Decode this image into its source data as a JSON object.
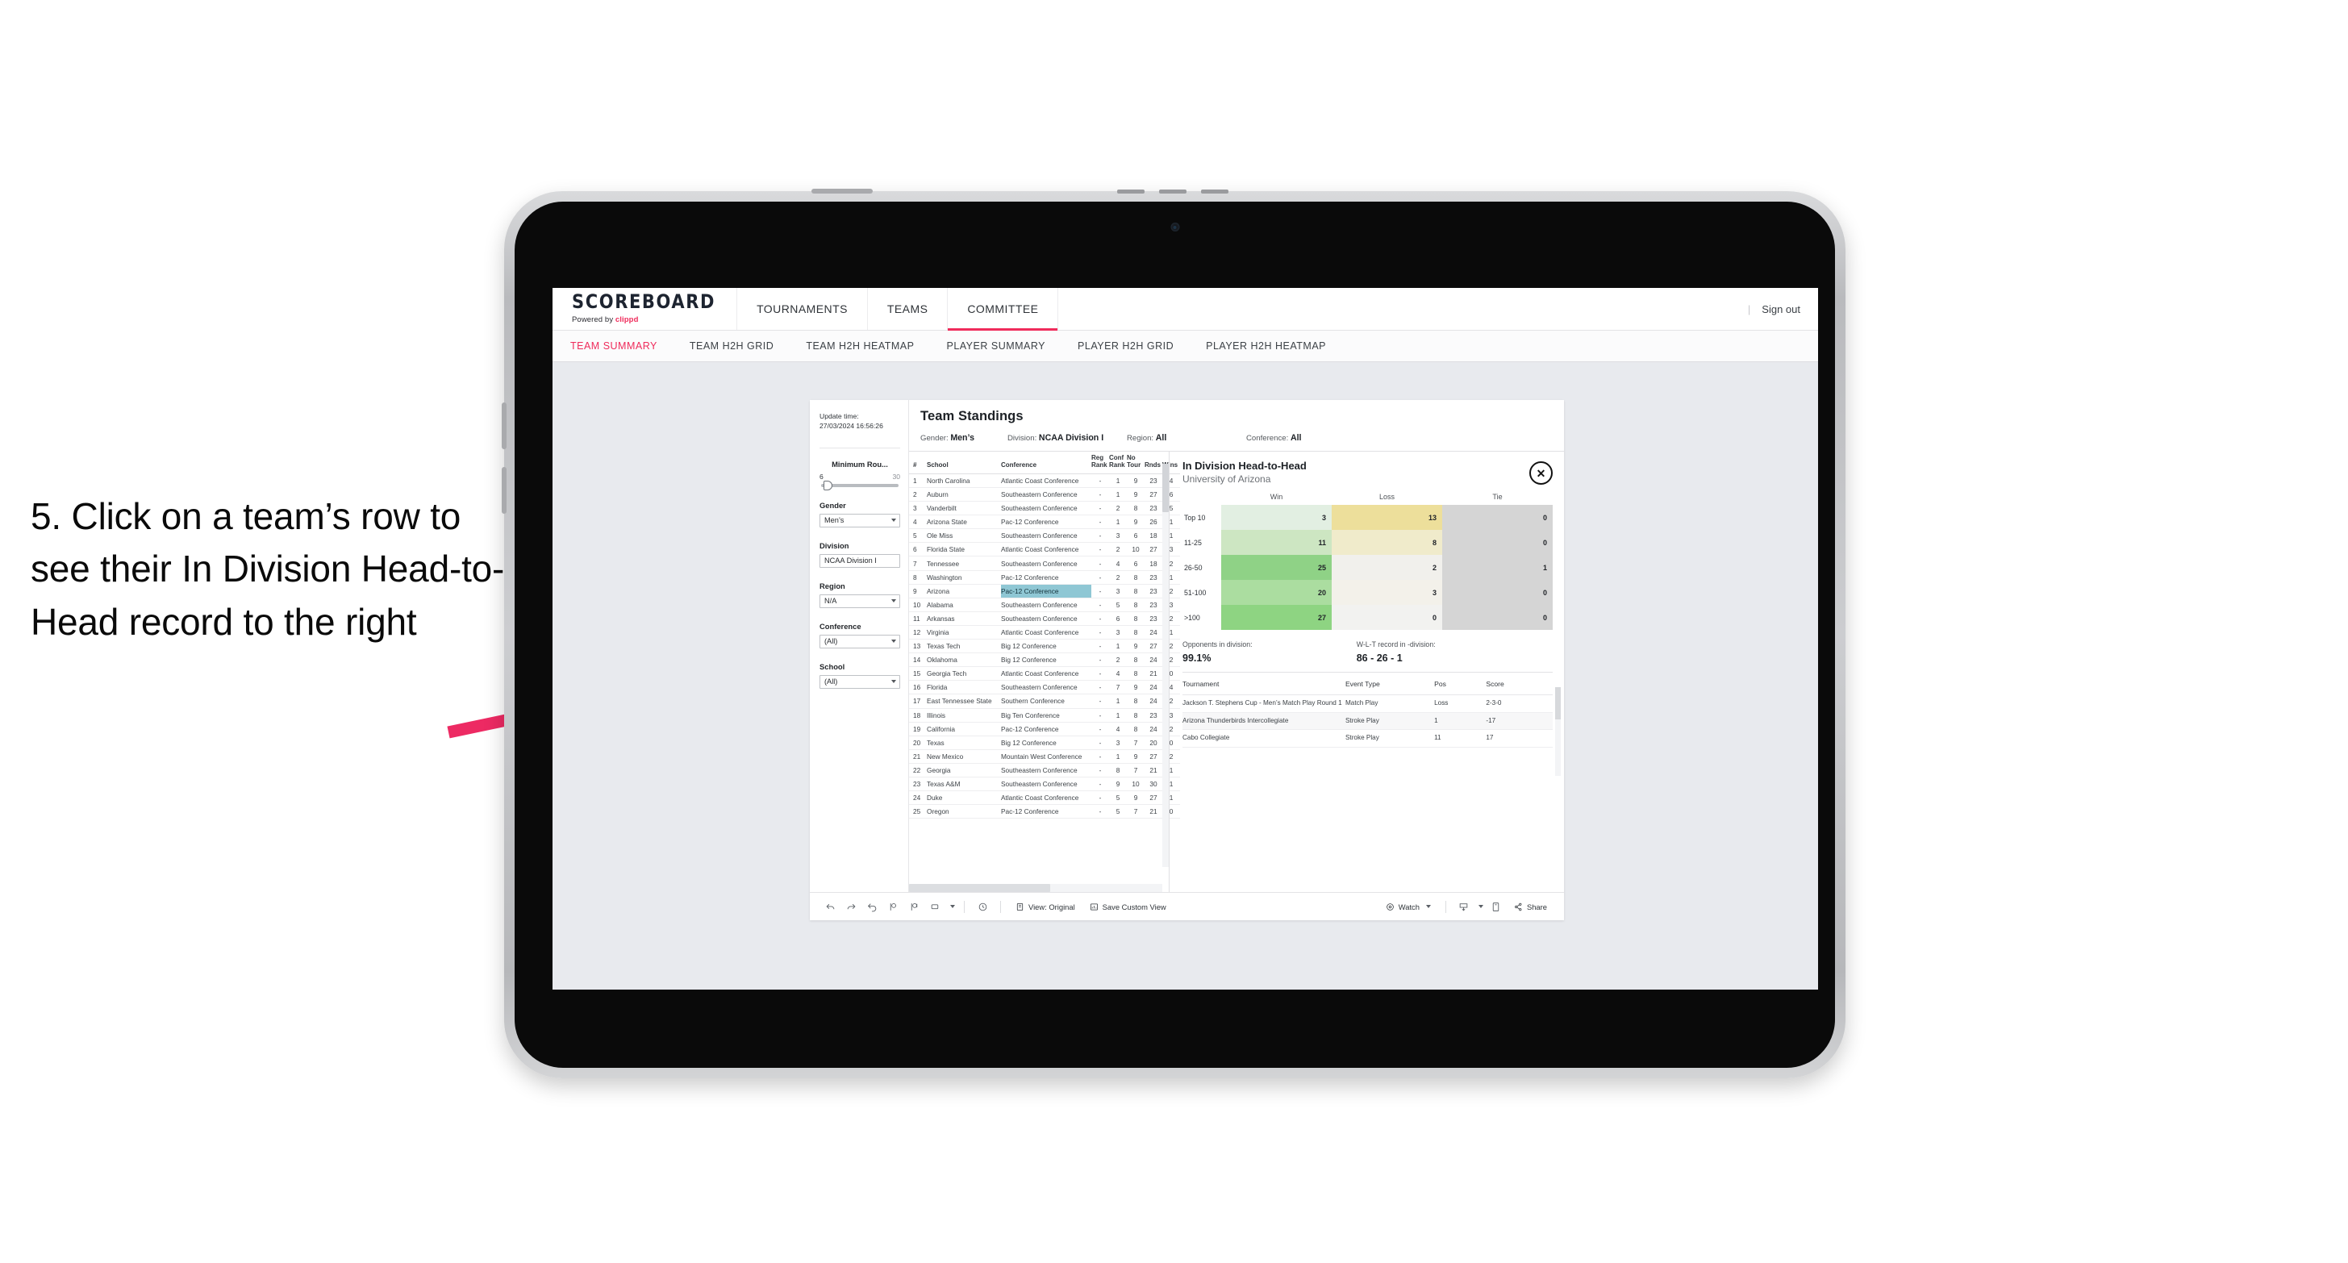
{
  "annotation": {
    "text": "5. Click on a team’s row to see their In Division Head-to-Head record to the right",
    "arrow_color": "#ED2A63"
  },
  "app": {
    "brand": {
      "title": "SCOREBOARD",
      "powered_prefix": "Powered by ",
      "powered_brand": "clippd"
    },
    "topnav": [
      {
        "label": "TOURNAMENTS",
        "active": false
      },
      {
        "label": "TEAMS",
        "active": false
      },
      {
        "label": "COMMITTEE",
        "active": true
      }
    ],
    "header_right": {
      "divider": "|",
      "sign_out": "Sign out"
    },
    "subnav": [
      {
        "label": "TEAM SUMMARY",
        "active": true
      },
      {
        "label": "TEAM H2H GRID",
        "active": false
      },
      {
        "label": "TEAM H2H HEATMAP",
        "active": false
      },
      {
        "label": "PLAYER SUMMARY",
        "active": false
      },
      {
        "label": "PLAYER H2H GRID",
        "active": false
      },
      {
        "label": "PLAYER H2H HEATMAP",
        "active": false
      }
    ]
  },
  "filters": {
    "update_time_label": "Update time:",
    "update_time_value": "27/03/2024 16:56:26",
    "slider": {
      "label": "Minimum Rou...",
      "min": "6",
      "max": "30",
      "value_pct": 3
    },
    "gender": {
      "label": "Gender",
      "value": "Men’s"
    },
    "division": {
      "label": "Division",
      "value": "NCAA Division I"
    },
    "region": {
      "label": "Region",
      "value": "N/A"
    },
    "conference": {
      "label": "Conference",
      "value": "(All)"
    },
    "school": {
      "label": "School",
      "value": "(All)"
    }
  },
  "standings": {
    "title": "Team Standings",
    "crumbs": [
      {
        "label": "Gender: ",
        "value": "Men’s"
      },
      {
        "label": "Division: ",
        "value": "NCAA Division I"
      },
      {
        "label": "Region: ",
        "value": "All"
      },
      {
        "label": "Conference: ",
        "value": "All"
      }
    ],
    "columns": [
      "#",
      "School",
      "Conference",
      "Reg Rank",
      "Conf Rank",
      "No Tour",
      "Rnds",
      "Wins"
    ],
    "rows": [
      {
        "rank": "1",
        "school": "North Carolina",
        "conference": "Atlantic Coast Conference",
        "reg_rank": "-",
        "conf_rank": "1",
        "no_tour": "9",
        "rnds": "23",
        "wins": "4",
        "selected": false
      },
      {
        "rank": "2",
        "school": "Auburn",
        "conference": "Southeastern Conference",
        "reg_rank": "-",
        "conf_rank": "1",
        "no_tour": "9",
        "rnds": "27",
        "wins": "6",
        "selected": false
      },
      {
        "rank": "3",
        "school": "Vanderbilt",
        "conference": "Southeastern Conference",
        "reg_rank": "-",
        "conf_rank": "2",
        "no_tour": "8",
        "rnds": "23",
        "wins": "5",
        "selected": false
      },
      {
        "rank": "4",
        "school": "Arizona State",
        "conference": "Pac-12 Conference",
        "reg_rank": "-",
        "conf_rank": "1",
        "no_tour": "9",
        "rnds": "26",
        "wins": "1",
        "selected": false
      },
      {
        "rank": "5",
        "school": "Ole Miss",
        "conference": "Southeastern Conference",
        "reg_rank": "-",
        "conf_rank": "3",
        "no_tour": "6",
        "rnds": "18",
        "wins": "1",
        "selected": false
      },
      {
        "rank": "6",
        "school": "Florida State",
        "conference": "Atlantic Coast Conference",
        "reg_rank": "-",
        "conf_rank": "2",
        "no_tour": "10",
        "rnds": "27",
        "wins": "3",
        "selected": false
      },
      {
        "rank": "7",
        "school": "Tennessee",
        "conference": "Southeastern Conference",
        "reg_rank": "-",
        "conf_rank": "4",
        "no_tour": "6",
        "rnds": "18",
        "wins": "2",
        "selected": false
      },
      {
        "rank": "8",
        "school": "Washington",
        "conference": "Pac-12 Conference",
        "reg_rank": "-",
        "conf_rank": "2",
        "no_tour": "8",
        "rnds": "23",
        "wins": "1",
        "selected": false
      },
      {
        "rank": "9",
        "school": "Arizona",
        "conference": "Pac-12 Conference",
        "reg_rank": "-",
        "conf_rank": "3",
        "no_tour": "8",
        "rnds": "23",
        "wins": "2",
        "selected": true
      },
      {
        "rank": "10",
        "school": "Alabama",
        "conference": "Southeastern Conference",
        "reg_rank": "-",
        "conf_rank": "5",
        "no_tour": "8",
        "rnds": "23",
        "wins": "3",
        "selected": false
      },
      {
        "rank": "11",
        "school": "Arkansas",
        "conference": "Southeastern Conference",
        "reg_rank": "-",
        "conf_rank": "6",
        "no_tour": "8",
        "rnds": "23",
        "wins": "2",
        "selected": false
      },
      {
        "rank": "12",
        "school": "Virginia",
        "conference": "Atlantic Coast Conference",
        "reg_rank": "-",
        "conf_rank": "3",
        "no_tour": "8",
        "rnds": "24",
        "wins": "1",
        "selected": false
      },
      {
        "rank": "13",
        "school": "Texas Tech",
        "conference": "Big 12 Conference",
        "reg_rank": "-",
        "conf_rank": "1",
        "no_tour": "9",
        "rnds": "27",
        "wins": "2",
        "selected": false
      },
      {
        "rank": "14",
        "school": "Oklahoma",
        "conference": "Big 12 Conference",
        "reg_rank": "-",
        "conf_rank": "2",
        "no_tour": "8",
        "rnds": "24",
        "wins": "2",
        "selected": false
      },
      {
        "rank": "15",
        "school": "Georgia Tech",
        "conference": "Atlantic Coast Conference",
        "reg_rank": "-",
        "conf_rank": "4",
        "no_tour": "8",
        "rnds": "21",
        "wins": "0",
        "selected": false
      },
      {
        "rank": "16",
        "school": "Florida",
        "conference": "Southeastern Conference",
        "reg_rank": "-",
        "conf_rank": "7",
        "no_tour": "9",
        "rnds": "24",
        "wins": "4",
        "selected": false
      },
      {
        "rank": "17",
        "school": "East Tennessee State",
        "conference": "Southern Conference",
        "reg_rank": "-",
        "conf_rank": "1",
        "no_tour": "8",
        "rnds": "24",
        "wins": "2",
        "selected": false
      },
      {
        "rank": "18",
        "school": "Illinois",
        "conference": "Big Ten Conference",
        "reg_rank": "-",
        "conf_rank": "1",
        "no_tour": "8",
        "rnds": "23",
        "wins": "3",
        "selected": false
      },
      {
        "rank": "19",
        "school": "California",
        "conference": "Pac-12 Conference",
        "reg_rank": "-",
        "conf_rank": "4",
        "no_tour": "8",
        "rnds": "24",
        "wins": "2",
        "selected": false
      },
      {
        "rank": "20",
        "school": "Texas",
        "conference": "Big 12 Conference",
        "reg_rank": "-",
        "conf_rank": "3",
        "no_tour": "7",
        "rnds": "20",
        "wins": "0",
        "selected": false
      },
      {
        "rank": "21",
        "school": "New Mexico",
        "conference": "Mountain West Conference",
        "reg_rank": "-",
        "conf_rank": "1",
        "no_tour": "9",
        "rnds": "27",
        "wins": "2",
        "selected": false
      },
      {
        "rank": "22",
        "school": "Georgia",
        "conference": "Southeastern Conference",
        "reg_rank": "-",
        "conf_rank": "8",
        "no_tour": "7",
        "rnds": "21",
        "wins": "1",
        "selected": false
      },
      {
        "rank": "23",
        "school": "Texas A&M",
        "conference": "Southeastern Conference",
        "reg_rank": "-",
        "conf_rank": "9",
        "no_tour": "10",
        "rnds": "30",
        "wins": "1",
        "selected": false
      },
      {
        "rank": "24",
        "school": "Duke",
        "conference": "Atlantic Coast Conference",
        "reg_rank": "-",
        "conf_rank": "5",
        "no_tour": "9",
        "rnds": "27",
        "wins": "1",
        "selected": false
      },
      {
        "rank": "25",
        "school": "Oregon",
        "conference": "Pac-12 Conference",
        "reg_rank": "-",
        "conf_rank": "5",
        "no_tour": "7",
        "rnds": "21",
        "wins": "0",
        "selected": false
      }
    ]
  },
  "h2h": {
    "title": "In Division Head-to-Head",
    "subtitle": "University of Arizona",
    "close_icon": "✕",
    "matrix": {
      "columns": [
        "Win",
        "Loss",
        "Tie"
      ],
      "rows": [
        {
          "band": "Top 10",
          "win": "3",
          "loss": "13",
          "tie": "0",
          "win_color": "#e2efe2",
          "loss_color": "#eddf9b",
          "tie_color": "#d5d5d5"
        },
        {
          "band": "11-25",
          "win": "11",
          "loss": "8",
          "tie": "0",
          "win_color": "#cde6c2",
          "loss_color": "#f0ebcb",
          "tie_color": "#d5d5d5"
        },
        {
          "band": "26-50",
          "win": "25",
          "loss": "2",
          "tie": "1",
          "win_color": "#8fd286",
          "loss_color": "#f1f0ec",
          "tie_color": "#d5d5d5"
        },
        {
          "band": "51-100",
          "win": "20",
          "loss": "3",
          "tie": "0",
          "win_color": "#abdda0",
          "loss_color": "#f3f1ea",
          "tie_color": "#d5d5d5"
        },
        {
          "band": ">100",
          "win": "27",
          "loss": "0",
          "tie": "0",
          "win_color": "#8ed482",
          "loss_color": "#f2f2f0",
          "tie_color": "#d5d5d5"
        }
      ]
    },
    "stats": [
      {
        "label": "Opponents in division:",
        "value": "99.1%"
      },
      {
        "label": "W-L-T record in -division:",
        "value": "86 - 26 - 1"
      }
    ],
    "tournaments": {
      "columns": [
        "Tournament",
        "Event Type",
        "Pos",
        "Score"
      ],
      "rows": [
        {
          "tournament": "Jackson T. Stephens Cup - Men’s Match Play Round 1",
          "event_type": "Match Play",
          "pos": "Loss",
          "score": "2-3-0"
        },
        {
          "tournament": "Arizona Thunderbirds Intercollegiate",
          "event_type": "Stroke Play",
          "pos": "1",
          "score": "-17"
        },
        {
          "tournament": "Cabo Collegiate",
          "event_type": "Stroke Play",
          "pos": "11",
          "score": "17"
        }
      ]
    }
  },
  "toolbar": {
    "view_label": "View: Original",
    "save_label": "Save Custom View",
    "watch_label": "Watch",
    "share_label": "Share"
  }
}
